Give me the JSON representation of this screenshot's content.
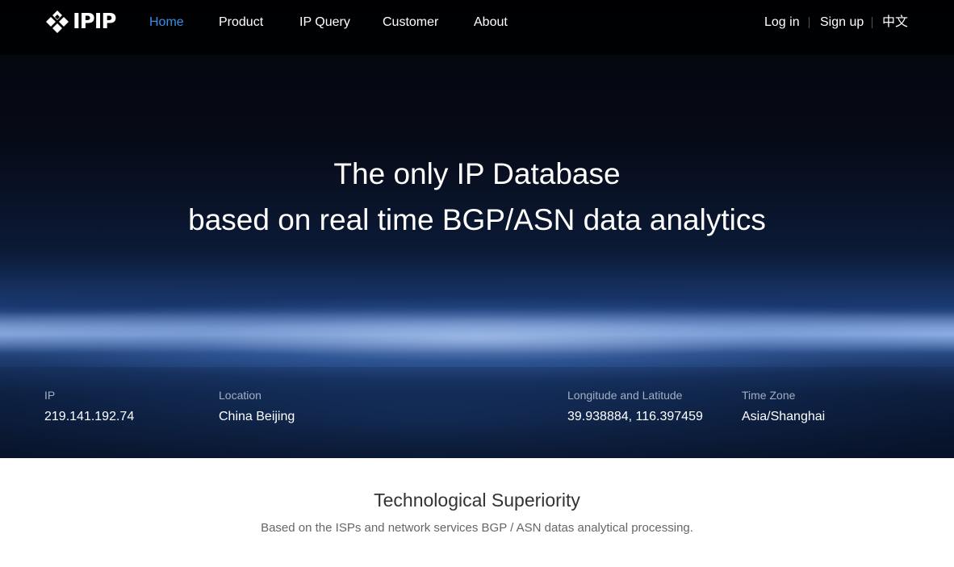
{
  "brand": {
    "logo_text": "IPIP",
    "logo_icon": "ipip-diamond-logo-icon"
  },
  "nav": {
    "items": [
      {
        "label": "Home",
        "active": true
      },
      {
        "label": "Product",
        "active": false
      },
      {
        "label": "IP Query",
        "active": false
      },
      {
        "label": "Customer",
        "active": false
      },
      {
        "label": "About",
        "active": false
      }
    ],
    "login": "Log in",
    "signup": "Sign up",
    "language": "中文"
  },
  "hero": {
    "headline_line1": "The only IP Database",
    "headline_line2": "based on real time BGP/ASN data analytics"
  },
  "ip_info": {
    "ip_label": "IP",
    "ip_value": "219.141.192.74",
    "location_label": "Location",
    "location_value": "China Beijing",
    "coords_label": "Longitude and Latitude",
    "coords_value": "39.938884, 116.397459",
    "timezone_label": "Time Zone",
    "timezone_value": "Asia/Shanghai"
  },
  "section": {
    "title": "Technological Superiority",
    "subtitle": "Based on the ISPs and network services BGP / ASN datas analytical processing."
  },
  "colors": {
    "nav_active": "#3a8ee6",
    "nav_text": "#ffffff",
    "section_title": "#333333",
    "section_subtitle": "#666666"
  }
}
